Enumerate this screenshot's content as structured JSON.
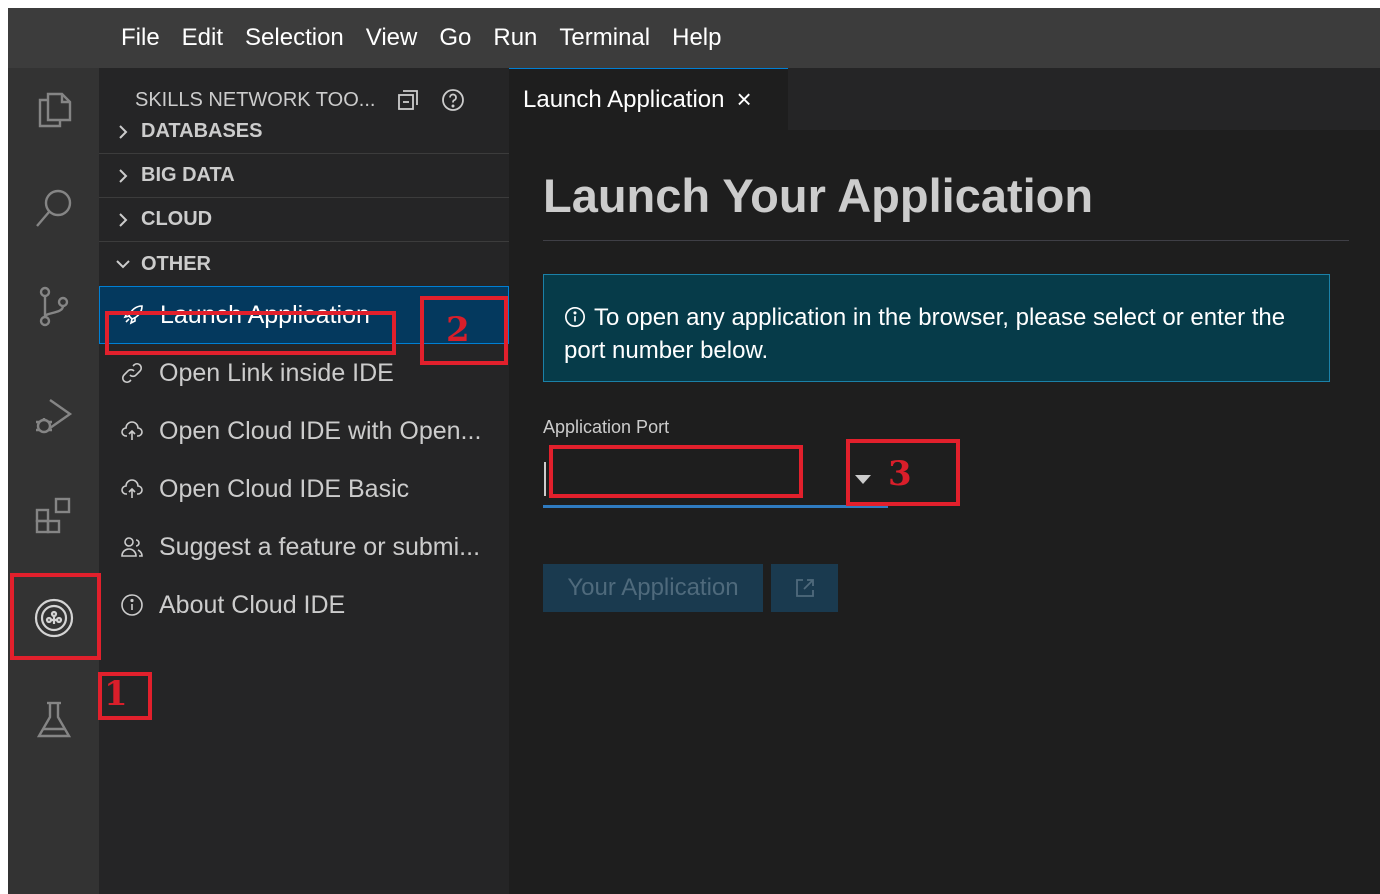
{
  "menubar": {
    "items": [
      "File",
      "Edit",
      "Selection",
      "View",
      "Go",
      "Run",
      "Terminal",
      "Help"
    ]
  },
  "activitybar": {
    "items": [
      {
        "name": "explorer",
        "icon": "files-icon"
      },
      {
        "name": "search",
        "icon": "search-icon"
      },
      {
        "name": "source-control",
        "icon": "source-control-icon"
      },
      {
        "name": "run-debug",
        "icon": "run-debug-icon"
      },
      {
        "name": "extensions",
        "icon": "extensions-icon"
      },
      {
        "name": "skills-network-toolbox",
        "icon": "skills-network-icon",
        "active": true
      },
      {
        "name": "testing",
        "icon": "flask-icon"
      }
    ]
  },
  "sidebar": {
    "title": "SKILLS NETWORK TOO...",
    "sections": [
      {
        "label": "DATABASES",
        "expanded": false
      },
      {
        "label": "BIG DATA",
        "expanded": false
      },
      {
        "label": "CLOUD",
        "expanded": false
      },
      {
        "label": "OTHER",
        "expanded": true
      }
    ],
    "items": [
      {
        "label": "Launch Application",
        "icon": "rocket-icon",
        "selected": true
      },
      {
        "label": "Open Link inside IDE",
        "icon": "link-icon"
      },
      {
        "label": "Open Cloud IDE with Open...",
        "icon": "cloud-upload-icon"
      },
      {
        "label": "Open Cloud IDE Basic",
        "icon": "cloud-upload-icon"
      },
      {
        "label": "Suggest a feature or submi...",
        "icon": "feedback-icon"
      },
      {
        "label": "About Cloud IDE",
        "icon": "info-icon"
      }
    ]
  },
  "tab": {
    "label": "Launch Application",
    "close": "×"
  },
  "editor": {
    "title": "Launch Your Application",
    "info_text": "To open any application in the browser, please select or enter the port number below.",
    "port_label": "Application Port",
    "port_value": "",
    "app_button": "Your Application"
  },
  "annotations": {
    "one": "1",
    "two": "2",
    "three": "3"
  },
  "colors": {
    "accent": "#007fd4",
    "annotation": "#e2202c",
    "info_bg": "#063b49"
  }
}
